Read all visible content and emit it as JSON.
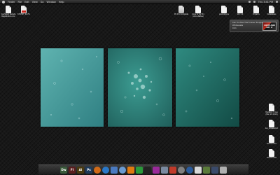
{
  "menubar": {
    "items": [
      "Finder",
      "File",
      "Edit",
      "View",
      "Go",
      "Window",
      "Help"
    ],
    "clock": "Thu 3:41 PM"
  },
  "desktop_icons": [
    {
      "label": "Cashback Rebate Registration.doc",
      "type": "doc"
    },
    {
      "label": "STCHNT_02.Fin",
      "type": "pdf"
    },
    {
      "label": "DV Pro Complete",
      "type": "app"
    },
    {
      "label": "Copy of DV Pro (Anne Bates)",
      "type": "doc"
    },
    {
      "label": "planning.xs",
      "type": "doc"
    },
    {
      "label": "Ver 1.0",
      "type": "doc"
    },
    {
      "label": "Projects",
      "type": "doc"
    },
    {
      "label": "Databases",
      "type": "doc"
    },
    {
      "label": "Madison 7 Ave (Mar 19 2010)",
      "type": "doc"
    },
    {
      "label": "dsc_screenshot",
      "type": "doc"
    },
    {
      "label": "headshot01",
      "type": "doc"
    },
    {
      "label": "headshot02",
      "type": "doc"
    }
  ],
  "itunes_widget": {
    "track": "Can You Feel The Forever Tonight",
    "artist": "Whitesnake",
    "time": "0:21",
    "album_art_text": "COME AND GET IT"
  },
  "dock": {
    "items": [
      {
        "name": "dreamweaver",
        "text": "Dw",
        "color": "#3a5a3a"
      },
      {
        "name": "flash",
        "text": "Fl",
        "color": "#5a1e1e"
      },
      {
        "name": "illustrator",
        "text": "Ai",
        "color": "#4a3a10"
      },
      {
        "name": "photoshop",
        "text": "Ps",
        "color": "#1e3a5a"
      },
      {
        "name": "firefox",
        "text": "",
        "color": "#d06a18"
      },
      {
        "name": "safari",
        "text": "",
        "color": "#2a78c8"
      },
      {
        "name": "itunes",
        "text": "",
        "color": "#4a7ac0"
      },
      {
        "name": "ichat",
        "text": "",
        "color": "#6a9ad0"
      },
      {
        "name": "vlc",
        "text": "",
        "color": "#e07a10"
      },
      {
        "name": "adium",
        "text": "",
        "color": "#2a9a3a"
      },
      {
        "name": "terminal",
        "text": "",
        "color": "#222222"
      },
      {
        "name": "cocktail",
        "text": "",
        "color": "#9a2a9a"
      },
      {
        "name": "mail",
        "text": "",
        "color": "#7a8aa0"
      },
      {
        "name": "cyberduck",
        "text": "",
        "color": "#c03a2a"
      },
      {
        "name": "system-preferences",
        "text": "",
        "color": "#808080"
      },
      {
        "name": "quicktime",
        "text": "",
        "color": "#2a5a9a"
      },
      {
        "name": "calendar",
        "text": "",
        "color": "#d8d8d8"
      },
      {
        "name": "iphoto",
        "text": "",
        "color": "#5a7a3a"
      },
      {
        "name": "stack",
        "text": "",
        "color": "#3a4a6a"
      },
      {
        "name": "trash",
        "text": "",
        "color": "#b0b0b0"
      }
    ]
  }
}
